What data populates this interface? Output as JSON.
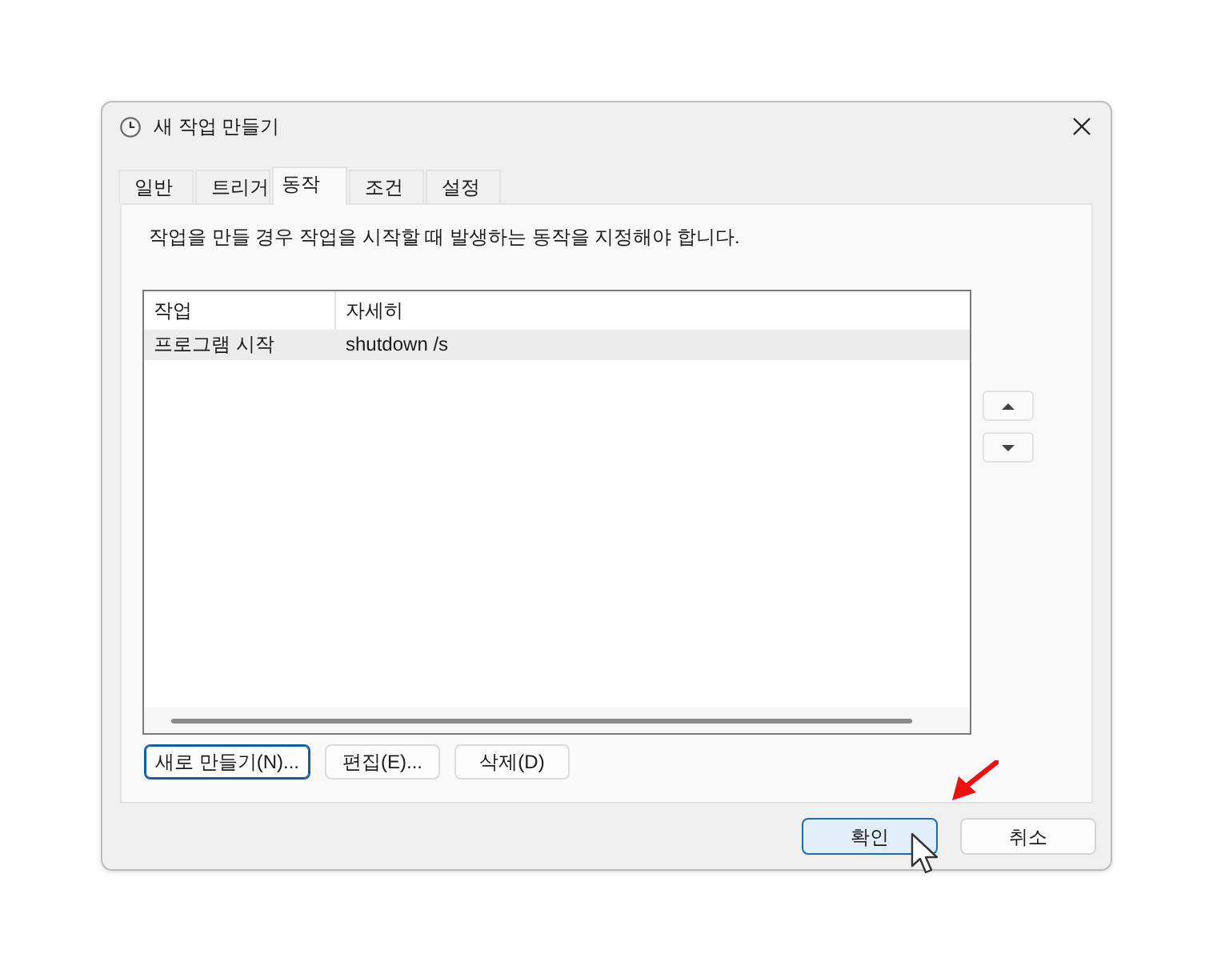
{
  "window": {
    "title": "새 작업 만들기"
  },
  "tabs": [
    {
      "label": "일반",
      "selected": false
    },
    {
      "label": "트리거",
      "selected": false
    },
    {
      "label": "동작",
      "selected": true
    },
    {
      "label": "조건",
      "selected": false
    },
    {
      "label": "설정",
      "selected": false
    }
  ],
  "description": "작업을 만들 경우 작업을 시작할 때 발생하는 동작을 지정해야 합니다.",
  "actions_table": {
    "columns": [
      "작업",
      "자세히"
    ],
    "rows": [
      {
        "cells": [
          "프로그램 시작",
          "shutdown /s"
        ],
        "selected": true
      }
    ]
  },
  "order_buttons": [
    {
      "kind": "up"
    },
    {
      "kind": "down"
    }
  ],
  "list_buttons": [
    {
      "label": "새로 만들기(N)...",
      "focused": true
    },
    {
      "label": "편집(E)...",
      "focused": false
    },
    {
      "label": "삭제(D)",
      "focused": false
    }
  ],
  "dialog_buttons": [
    {
      "label": "확인",
      "default": true
    },
    {
      "label": "취소",
      "default": false
    }
  ]
}
